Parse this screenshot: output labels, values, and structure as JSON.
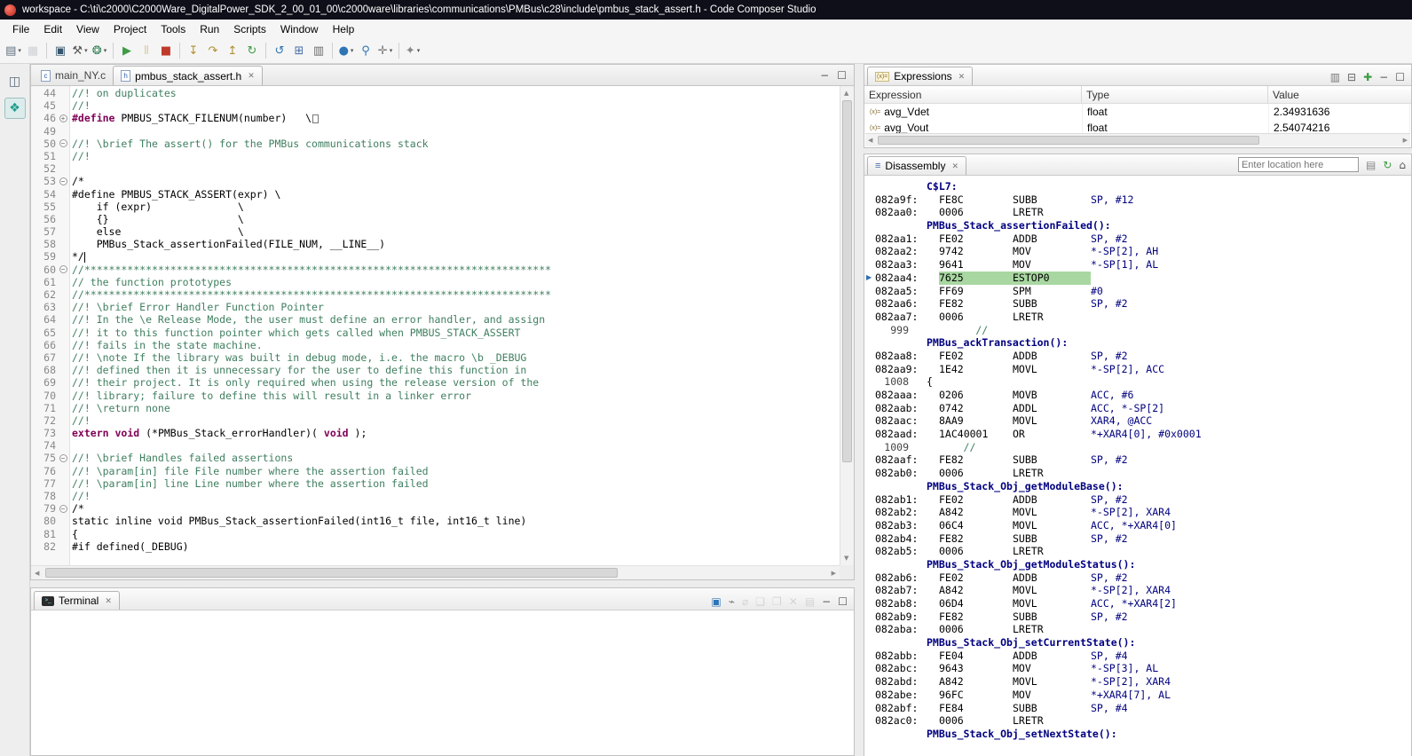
{
  "title_bar": {
    "title": "workspace - C:\\ti\\c2000\\C2000Ware_DigitalPower_SDK_2_00_01_00\\c2000ware\\libraries\\communications\\PMBus\\c28\\include\\pmbus_stack_assert.h - Code Composer Studio"
  },
  "menu": [
    "File",
    "Edit",
    "View",
    "Project",
    "Tools",
    "Run",
    "Scripts",
    "Window",
    "Help"
  ],
  "toolbar": [
    {
      "name": "new-file-icon",
      "glyph": "▤",
      "color": "#5f6e7d",
      "dropdown": true
    },
    {
      "name": "save-icon",
      "glyph": "▦",
      "color": "#8d9aa5",
      "disabled": true
    },
    {
      "sep": true
    },
    {
      "name": "target-config-icon",
      "glyph": "▣",
      "color": "#35566f"
    },
    {
      "name": "build-icon",
      "glyph": "⚒",
      "color": "#5a5a5a",
      "dropdown": true
    },
    {
      "name": "debug-icon",
      "glyph": "❂",
      "color": "#2e7d4f",
      "dropdown": true
    },
    {
      "sep": true
    },
    {
      "name": "resume-icon",
      "glyph": "▶",
      "color": "#3f9c46"
    },
    {
      "name": "suspend-icon",
      "glyph": "Ⅱ",
      "color": "#b08f2e",
      "disabled": true
    },
    {
      "name": "terminate-icon",
      "glyph": "■",
      "color": "#c03a2b"
    },
    {
      "sep": true
    },
    {
      "name": "step-into-icon",
      "glyph": "↧",
      "color": "#b08f2e"
    },
    {
      "name": "step-over-icon",
      "glyph": "↷",
      "color": "#b08f2e"
    },
    {
      "name": "step-return-icon",
      "glyph": "↥",
      "color": "#b08f2e"
    },
    {
      "name": "restart-icon",
      "glyph": "↻",
      "color": "#3f9c46"
    },
    {
      "sep": true
    },
    {
      "name": "refresh-icon",
      "glyph": "↺",
      "color": "#2e75b6"
    },
    {
      "name": "memory-icon",
      "glyph": "⊞",
      "color": "#4a6da7"
    },
    {
      "name": "registers-icon",
      "glyph": "▥",
      "color": "#6b6b6b"
    },
    {
      "sep": true
    },
    {
      "name": "new-breakpoint-icon",
      "glyph": "●",
      "color": "#2e75b6",
      "dropdown": true
    },
    {
      "name": "search-icon",
      "glyph": "⚲",
      "color": "#2e75b6"
    },
    {
      "name": "open-element-icon",
      "glyph": "✛",
      "color": "#777777",
      "dropdown": true
    },
    {
      "sep": true
    },
    {
      "name": "pin-icon",
      "glyph": "✦",
      "color": "#888888",
      "dropdown": true
    }
  ],
  "fastview": [
    {
      "name": "restore-views-icon",
      "glyph": "◫",
      "color": "#5a6b7a",
      "active": false
    },
    {
      "name": "debug-perspective-icon",
      "glyph": "❖",
      "color": "#1f9e8e",
      "active": true
    }
  ],
  "editor": {
    "tabs": [
      {
        "label": "main_NY.c",
        "file_type": "c",
        "active": false,
        "closable": false
      },
      {
        "label": "pmbus_stack_assert.h",
        "file_type": "h",
        "active": true,
        "closable": true
      }
    ],
    "window_icons": [
      {
        "name": "minimize-icon",
        "glyph": "−",
        "color": "#555555"
      },
      {
        "name": "maximize-icon",
        "glyph": "☐",
        "color": "#555555"
      }
    ],
    "lines": [
      {
        "n": 44,
        "s": [
          [
            "//! on duplicates",
            "c"
          ]
        ]
      },
      {
        "n": 45,
        "s": [
          [
            "//!",
            "c"
          ]
        ]
      },
      {
        "n": 46,
        "f": "+",
        "s": [
          [
            "#define ",
            "k"
          ],
          [
            "PMBUS_STACK_FILENUM(number)   \\",
            "p"
          ],
          [
            "",
            "x"
          ]
        ]
      },
      {
        "n": 49,
        "s": []
      },
      {
        "n": 50,
        "f": "-",
        "s": [
          [
            "//! \\brief The assert() for the PMBus communications stack",
            "c"
          ]
        ]
      },
      {
        "n": 51,
        "s": [
          [
            "//!",
            "c"
          ]
        ]
      },
      {
        "n": 52,
        "s": []
      },
      {
        "n": 53,
        "f": "-",
        "s": [
          [
            "/*",
            "p"
          ]
        ]
      },
      {
        "n": 54,
        "s": [
          [
            "#define PMBUS_STACK_ASSERT(expr) \\",
            "p"
          ]
        ]
      },
      {
        "n": 55,
        "s": [
          [
            "    if (expr)              \\",
            "p"
          ]
        ]
      },
      {
        "n": 56,
        "s": [
          [
            "    {}                     \\",
            "p"
          ]
        ]
      },
      {
        "n": 57,
        "s": [
          [
            "    else                   \\",
            "p"
          ]
        ]
      },
      {
        "n": 58,
        "s": [
          [
            "    PMBus_Stack_assertionFailed(FILE_NUM, __LINE__)",
            "p"
          ]
        ]
      },
      {
        "n": 59,
        "caret": true,
        "s": [
          [
            "*/",
            "p"
          ]
        ]
      },
      {
        "n": 60,
        "f": "-",
        "s": [
          [
            "//****************************************************************************",
            "c"
          ]
        ]
      },
      {
        "n": 61,
        "s": [
          [
            "// the function prototypes",
            "c"
          ]
        ]
      },
      {
        "n": 62,
        "s": [
          [
            "//****************************************************************************",
            "c"
          ]
        ]
      },
      {
        "n": 63,
        "s": [
          [
            "//! \\brief Error Handler Function Pointer",
            "c"
          ]
        ]
      },
      {
        "n": 64,
        "s": [
          [
            "//! In the \\e Release Mode, the user must define an error handler, and assign",
            "c"
          ]
        ]
      },
      {
        "n": 65,
        "s": [
          [
            "//! it to this function pointer which gets called when PMBUS_STACK_ASSERT",
            "c"
          ]
        ]
      },
      {
        "n": 66,
        "s": [
          [
            "//! fails in the state machine.",
            "c"
          ]
        ]
      },
      {
        "n": 67,
        "s": [
          [
            "//! \\note If the library was built in debug mode, i.e. the macro \\b _DEBUG",
            "c"
          ]
        ]
      },
      {
        "n": 68,
        "s": [
          [
            "//! defined then it is unnecessary for the user to define this function in",
            "c"
          ]
        ]
      },
      {
        "n": 69,
        "s": [
          [
            "//! their project. It is only required when using the release version of the",
            "c"
          ]
        ]
      },
      {
        "n": 70,
        "s": [
          [
            "//! library; failure to define this will result in a linker error",
            "c"
          ]
        ]
      },
      {
        "n": 71,
        "s": [
          [
            "//! \\return none",
            "c"
          ]
        ]
      },
      {
        "n": 72,
        "s": [
          [
            "//!",
            "c"
          ]
        ]
      },
      {
        "n": 73,
        "s": [
          [
            "extern",
            "k"
          ],
          [
            " ",
            "p"
          ],
          [
            "void",
            "k"
          ],
          [
            " (*PMBus_Stack_errorHandler)( ",
            "p"
          ],
          [
            "void",
            "k"
          ],
          [
            " );",
            "p"
          ]
        ]
      },
      {
        "n": 74,
        "s": []
      },
      {
        "n": 75,
        "f": "-",
        "s": [
          [
            "//! \\brief Handles failed assertions",
            "c"
          ]
        ]
      },
      {
        "n": 76,
        "s": [
          [
            "//! \\param[in] file File number where the assertion failed",
            "c"
          ]
        ]
      },
      {
        "n": 77,
        "s": [
          [
            "//! \\param[in] line Line number where the assertion failed",
            "c"
          ]
        ]
      },
      {
        "n": 78,
        "s": [
          [
            "//!",
            "c"
          ]
        ]
      },
      {
        "n": 79,
        "f": "-",
        "s": [
          [
            "/*",
            "p"
          ]
        ]
      },
      {
        "n": 80,
        "s": [
          [
            "static inline void PMBus_Stack_assertionFailed(int16_t file, int16_t line)",
            "p"
          ]
        ]
      },
      {
        "n": 81,
        "s": [
          [
            "{",
            "p"
          ]
        ]
      },
      {
        "n": 82,
        "s": [
          [
            "#if defined(_DEBUG)",
            "p"
          ]
        ]
      }
    ]
  },
  "terminal": {
    "label": "Terminal",
    "icons": [
      {
        "name": "open-terminal-icon",
        "glyph": "▣",
        "color": "#2e75b6"
      },
      {
        "name": "connect-icon",
        "glyph": "⌁",
        "color": "#777777"
      },
      {
        "name": "disconnect-icon",
        "glyph": "⌀",
        "color": "#aaaaaa",
        "disabled": true
      },
      {
        "name": "copy-icon",
        "glyph": "❏",
        "color": "#aaaaaa",
        "disabled": true
      },
      {
        "name": "paste-icon",
        "glyph": "❐",
        "color": "#aaaaaa",
        "disabled": true
      },
      {
        "name": "clear-terminal-icon",
        "glyph": "✕",
        "color": "#aaaaaa",
        "disabled": true
      },
      {
        "name": "scroll-lock-icon",
        "glyph": "▤",
        "color": "#aaaaaa",
        "disabled": true
      },
      {
        "name": "minimize-icon",
        "glyph": "−",
        "color": "#555555"
      },
      {
        "name": "maximize-icon",
        "glyph": "☐",
        "color": "#555555"
      }
    ]
  },
  "expressions": {
    "title": "Expressions",
    "columns": [
      "Expression",
      "Type",
      "Value"
    ],
    "toolbar_icons": [
      {
        "name": "show-type-names-icon",
        "glyph": "▥",
        "color": "#777777"
      },
      {
        "name": "collapse-all-icon",
        "glyph": "⊟",
        "color": "#666666"
      },
      {
        "name": "add-expression-icon",
        "glyph": "✚",
        "color": "#3f9c46"
      },
      {
        "name": "minimize-icon",
        "glyph": "−",
        "color": "#555555"
      },
      {
        "name": "maximize-icon",
        "glyph": "☐",
        "color": "#555555"
      }
    ],
    "rows": [
      {
        "expr": "avg_Vdet",
        "type": "float",
        "value": "2.34931636"
      },
      {
        "expr": "avg_Vout",
        "type": "float",
        "value": "2.54074216"
      }
    ]
  },
  "disassembly": {
    "title": "Disassembly",
    "location_placeholder": "Enter location here",
    "toolbar_icons": [
      {
        "name": "link-with-debug-icon",
        "glyph": "▤",
        "color": "#888888"
      },
      {
        "name": "refresh-icon",
        "glyph": "↻",
        "color": "#3f9c46"
      },
      {
        "name": "home-icon",
        "glyph": "⌂",
        "color": "#555555"
      }
    ],
    "rows": [
      {
        "t": "label",
        "text": "C$L7:"
      },
      {
        "t": "ins",
        "addr": "082a9f:",
        "code": "FE8C",
        "mn": "SUBB",
        "ops": "SP, #12"
      },
      {
        "t": "ins",
        "addr": "082aa0:",
        "code": "0006",
        "mn": "LRETR",
        "ops": ""
      },
      {
        "t": "label",
        "text": "PMBus_Stack_assertionFailed():"
      },
      {
        "t": "ins",
        "addr": "082aa1:",
        "code": "FE02",
        "mn": "ADDB",
        "ops": "SP, #2"
      },
      {
        "t": "ins",
        "addr": "082aa2:",
        "code": "9742",
        "mn": "MOV",
        "ops": "*-SP[2], AH"
      },
      {
        "t": "ins",
        "addr": "082aa3:",
        "code": "9641",
        "mn": "MOV",
        "ops": "*-SP[1], AL"
      },
      {
        "t": "ins",
        "addr": "082aa4:",
        "code": "7625",
        "mn": "ESTOP0",
        "ops": "",
        "hl": true,
        "arrow": true
      },
      {
        "t": "ins",
        "addr": "082aa5:",
        "code": "FF69",
        "mn": "SPM",
        "ops": "#0"
      },
      {
        "t": "ins",
        "addr": "082aa6:",
        "code": "FE82",
        "mn": "SUBB",
        "ops": "SP, #2"
      },
      {
        "t": "ins",
        "addr": "082aa7:",
        "code": "0006",
        "mn": "LRETR",
        "ops": ""
      },
      {
        "t": "src",
        "n": "999",
        "text": "        //",
        "cls": "c"
      },
      {
        "t": "label",
        "text": "PMBus_ackTransaction():"
      },
      {
        "t": "ins",
        "addr": "082aa8:",
        "code": "FE02",
        "mn": "ADDB",
        "ops": "SP, #2"
      },
      {
        "t": "ins",
        "addr": "082aa9:",
        "code": "1E42",
        "mn": "MOVL",
        "ops": "*-SP[2], ACC"
      },
      {
        "t": "src",
        "n": "1008",
        "text": "{",
        "cls": "p"
      },
      {
        "t": "ins",
        "addr": "082aaa:",
        "code": "0206",
        "mn": "MOVB",
        "ops": "ACC, #6"
      },
      {
        "t": "ins",
        "addr": "082aab:",
        "code": "0742",
        "mn": "ADDL",
        "ops": "ACC, *-SP[2]"
      },
      {
        "t": "ins",
        "addr": "082aac:",
        "code": "8AA9",
        "mn": "MOVL",
        "ops": "XAR4, @ACC"
      },
      {
        "t": "ins",
        "addr": "082aad:",
        "code": "1AC40001",
        "mn": "OR",
        "ops": "*+XAR4[0], #0x0001"
      },
      {
        "t": "src",
        "n": "1009",
        "text": "      //",
        "cls": "c"
      },
      {
        "t": "ins",
        "addr": "082aaf:",
        "code": "FE82",
        "mn": "SUBB",
        "ops": "SP, #2"
      },
      {
        "t": "ins",
        "addr": "082ab0:",
        "code": "0006",
        "mn": "LRETR",
        "ops": ""
      },
      {
        "t": "label",
        "text": "PMBus_Stack_Obj_getModuleBase():"
      },
      {
        "t": "ins",
        "addr": "082ab1:",
        "code": "FE02",
        "mn": "ADDB",
        "ops": "SP, #2"
      },
      {
        "t": "ins",
        "addr": "082ab2:",
        "code": "A842",
        "mn": "MOVL",
        "ops": "*-SP[2], XAR4"
      },
      {
        "t": "ins",
        "addr": "082ab3:",
        "code": "06C4",
        "mn": "MOVL",
        "ops": "ACC, *+XAR4[0]"
      },
      {
        "t": "ins",
        "addr": "082ab4:",
        "code": "FE82",
        "mn": "SUBB",
        "ops": "SP, #2"
      },
      {
        "t": "ins",
        "addr": "082ab5:",
        "code": "0006",
        "mn": "LRETR",
        "ops": ""
      },
      {
        "t": "label",
        "text": "PMBus_Stack_Obj_getModuleStatus():"
      },
      {
        "t": "ins",
        "addr": "082ab6:",
        "code": "FE02",
        "mn": "ADDB",
        "ops": "SP, #2"
      },
      {
        "t": "ins",
        "addr": "082ab7:",
        "code": "A842",
        "mn": "MOVL",
        "ops": "*-SP[2], XAR4"
      },
      {
        "t": "ins",
        "addr": "082ab8:",
        "code": "06D4",
        "mn": "MOVL",
        "ops": "ACC, *+XAR4[2]"
      },
      {
        "t": "ins",
        "addr": "082ab9:",
        "code": "FE82",
        "mn": "SUBB",
        "ops": "SP, #2"
      },
      {
        "t": "ins",
        "addr": "082aba:",
        "code": "0006",
        "mn": "LRETR",
        "ops": ""
      },
      {
        "t": "label",
        "text": "PMBus_Stack_Obj_setCurrentState():"
      },
      {
        "t": "ins",
        "addr": "082abb:",
        "code": "FE04",
        "mn": "ADDB",
        "ops": "SP, #4"
      },
      {
        "t": "ins",
        "addr": "082abc:",
        "code": "9643",
        "mn": "MOV",
        "ops": "*-SP[3], AL"
      },
      {
        "t": "ins",
        "addr": "082abd:",
        "code": "A842",
        "mn": "MOVL",
        "ops": "*-SP[2], XAR4"
      },
      {
        "t": "ins",
        "addr": "082abe:",
        "code": "96FC",
        "mn": "MOV",
        "ops": "*+XAR4[7], AL"
      },
      {
        "t": "ins",
        "addr": "082abf:",
        "code": "FE84",
        "mn": "SUBB",
        "ops": "SP, #4"
      },
      {
        "t": "ins",
        "addr": "082ac0:",
        "code": "0006",
        "mn": "LRETR",
        "ops": ""
      },
      {
        "t": "label",
        "text": "PMBus_Stack_Obj_setNextState():"
      }
    ]
  }
}
